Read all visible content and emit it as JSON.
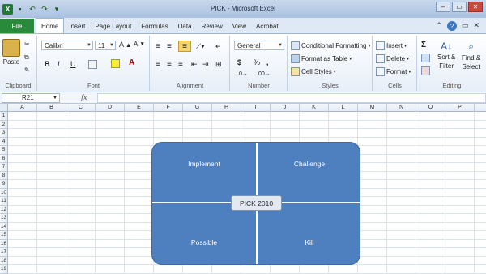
{
  "window": {
    "title": "PICK - Microsoft Excel"
  },
  "tabs": [
    "File",
    "Home",
    "Insert",
    "Page Layout",
    "Formulas",
    "Data",
    "Review",
    "View",
    "Acrobat"
  ],
  "ribbon": {
    "clipboard": {
      "paste": "Paste",
      "label": "Clipboard"
    },
    "font": {
      "name": "Calibri",
      "size": "11",
      "label": "Font",
      "bold": "B",
      "italic": "I",
      "underline": "U"
    },
    "alignment": {
      "label": "Alignment"
    },
    "number": {
      "format": "General",
      "currency": "$",
      "percent": "%",
      "comma": ",",
      "label": "Number"
    },
    "styles": {
      "conditional": "Conditional Formatting",
      "table": "Format as Table",
      "cell": "Cell Styles",
      "label": "Styles"
    },
    "cells": {
      "insert": "Insert",
      "delete": "Delete",
      "format": "Format",
      "label": "Cells"
    },
    "editing": {
      "sigma": "Σ",
      "sort": "Sort &",
      "filter": "Filter",
      "find": "Find &",
      "select": "Select",
      "label": "Editing"
    }
  },
  "formula_bar": {
    "name_box": "R21",
    "fx": "fx",
    "value": ""
  },
  "columns": [
    "A",
    "B",
    "C",
    "D",
    "E",
    "F",
    "G",
    "H",
    "I",
    "J",
    "K",
    "L",
    "M",
    "N",
    "O",
    "P",
    "Q"
  ],
  "rows": [
    "1",
    "2",
    "3",
    "4",
    "5",
    "6",
    "7",
    "8",
    "9",
    "10",
    "11",
    "12",
    "13",
    "14",
    "15",
    "16",
    "17",
    "18",
    "19"
  ],
  "diagram": {
    "top_left": "Implement",
    "top_right": "Challenge",
    "bottom_left": "Possible",
    "bottom_right": "Kill",
    "center": "PICK 2010"
  },
  "colors": {
    "quadrant_fill": "#4e7fbf",
    "file_tab": "#2a8a3c"
  }
}
